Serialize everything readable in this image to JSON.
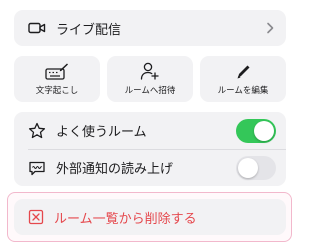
{
  "menu": {
    "live": {
      "label": "ライブ配信",
      "icon": "video-camera-icon"
    },
    "actions": [
      {
        "label": "文字起こし",
        "icon": "keyboard-pen-icon"
      },
      {
        "label": "ルームへ招待",
        "icon": "add-person-icon"
      },
      {
        "label": "ルームを編集",
        "icon": "pencil-icon"
      }
    ],
    "toggles": [
      {
        "label": "よく使うルーム",
        "icon": "star-icon",
        "on": true
      },
      {
        "label": "外部通知の読み上げ",
        "icon": "speech-bubble-icon",
        "on": false
      }
    ],
    "delete": {
      "label": "ルーム一覧から削除する",
      "icon": "delete-box-icon"
    }
  },
  "colors": {
    "toggle_on": "#34c759",
    "toggle_off": "#e4e4e8",
    "danger": "#e5484d",
    "highlight_border": "#f2b8cc",
    "card_bg": "#f2f2f4"
  }
}
